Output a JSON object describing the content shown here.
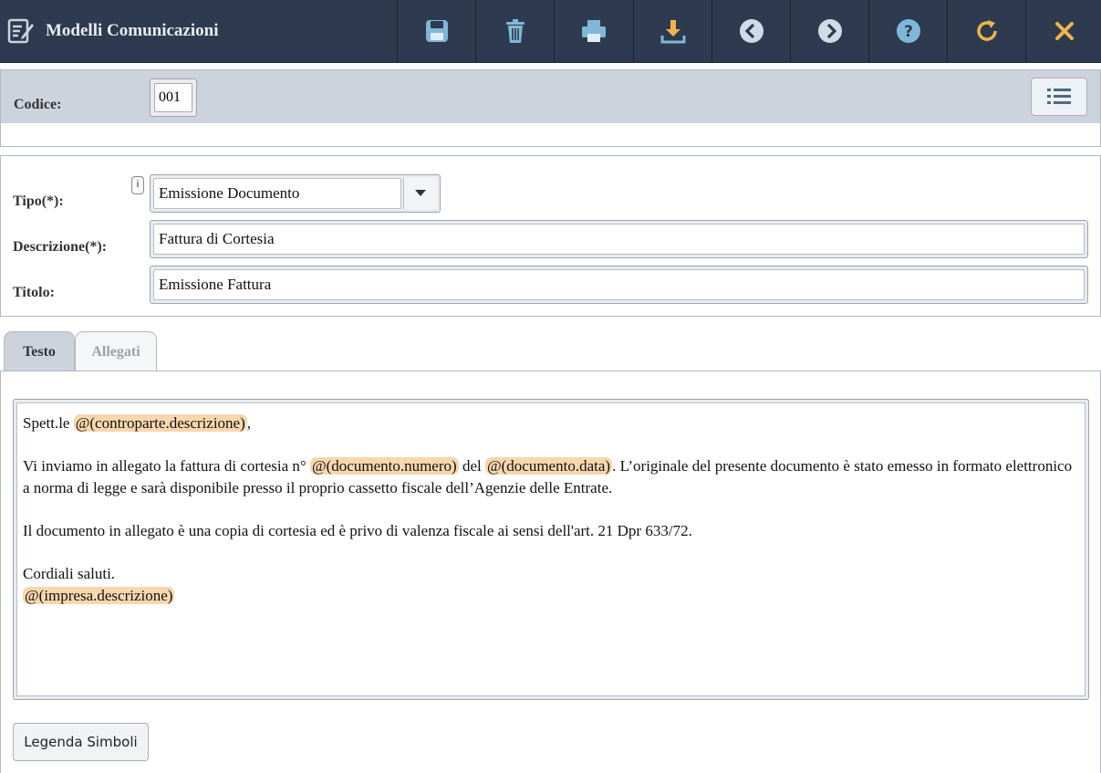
{
  "header": {
    "title": "Modelli Comunicazioni",
    "title_icon": "edit-document-icon",
    "toolbar": [
      {
        "name": "save-button",
        "icon": "floppy-icon"
      },
      {
        "name": "delete-button",
        "icon": "trash-icon"
      },
      {
        "name": "print-button",
        "icon": "printer-icon"
      },
      {
        "name": "download-button",
        "icon": "download-icon"
      },
      {
        "name": "previous-button",
        "icon": "chevron-left-circle-icon"
      },
      {
        "name": "next-button",
        "icon": "chevron-right-circle-icon"
      },
      {
        "name": "help-button",
        "icon": "question-circle-icon"
      },
      {
        "name": "refresh-button",
        "icon": "refresh-icon"
      },
      {
        "name": "close-button",
        "icon": "close-icon"
      }
    ]
  },
  "codice": {
    "label": "Codice:",
    "value": "001"
  },
  "form": {
    "tipo": {
      "label": "Tipo(*):",
      "value": "Emissione Documento",
      "info": "i"
    },
    "descrizione": {
      "label": "Descrizione(*):",
      "value": "Fattura di Cortesia"
    },
    "titolo": {
      "label": "Titolo:",
      "value": "Emissione Fattura"
    }
  },
  "tabs": [
    {
      "label": "Testo",
      "active": true
    },
    {
      "label": "Allegati",
      "active": false
    }
  ],
  "editor": {
    "greeting_prefix": "Spett.le ",
    "greeting_tag": "@(controparte.descrizione)",
    "greeting_suffix": ",",
    "p1_a": "Vi inviamo in allegato la fattura di cortesia n° ",
    "p1_tag1": "@(documento.numero)",
    "p1_b": " del ",
    "p1_tag2": "@(documento.data)",
    "p1_c": ". L’originale del presente documento è stato emesso in formato elettronico a norma di legge e sarà disponibile presso il proprio cassetto fiscale dell’Agenzie delle Entrate.",
    "p2": "Il documento in allegato è una copia di cortesia ed è privo di valenza fiscale ai sensi dell'art. 21 Dpr 633/72.",
    "closing": "Cordiali saluti.",
    "signature_tag": "@(impresa.descrizione)"
  },
  "legend_button": "Legenda Simboli",
  "colors": {
    "topbar": "#2d3a4f",
    "accent_icons": "#7fb8d6",
    "tag_highlight": "#f8d7ad",
    "close_icon": "#f0b44a"
  }
}
